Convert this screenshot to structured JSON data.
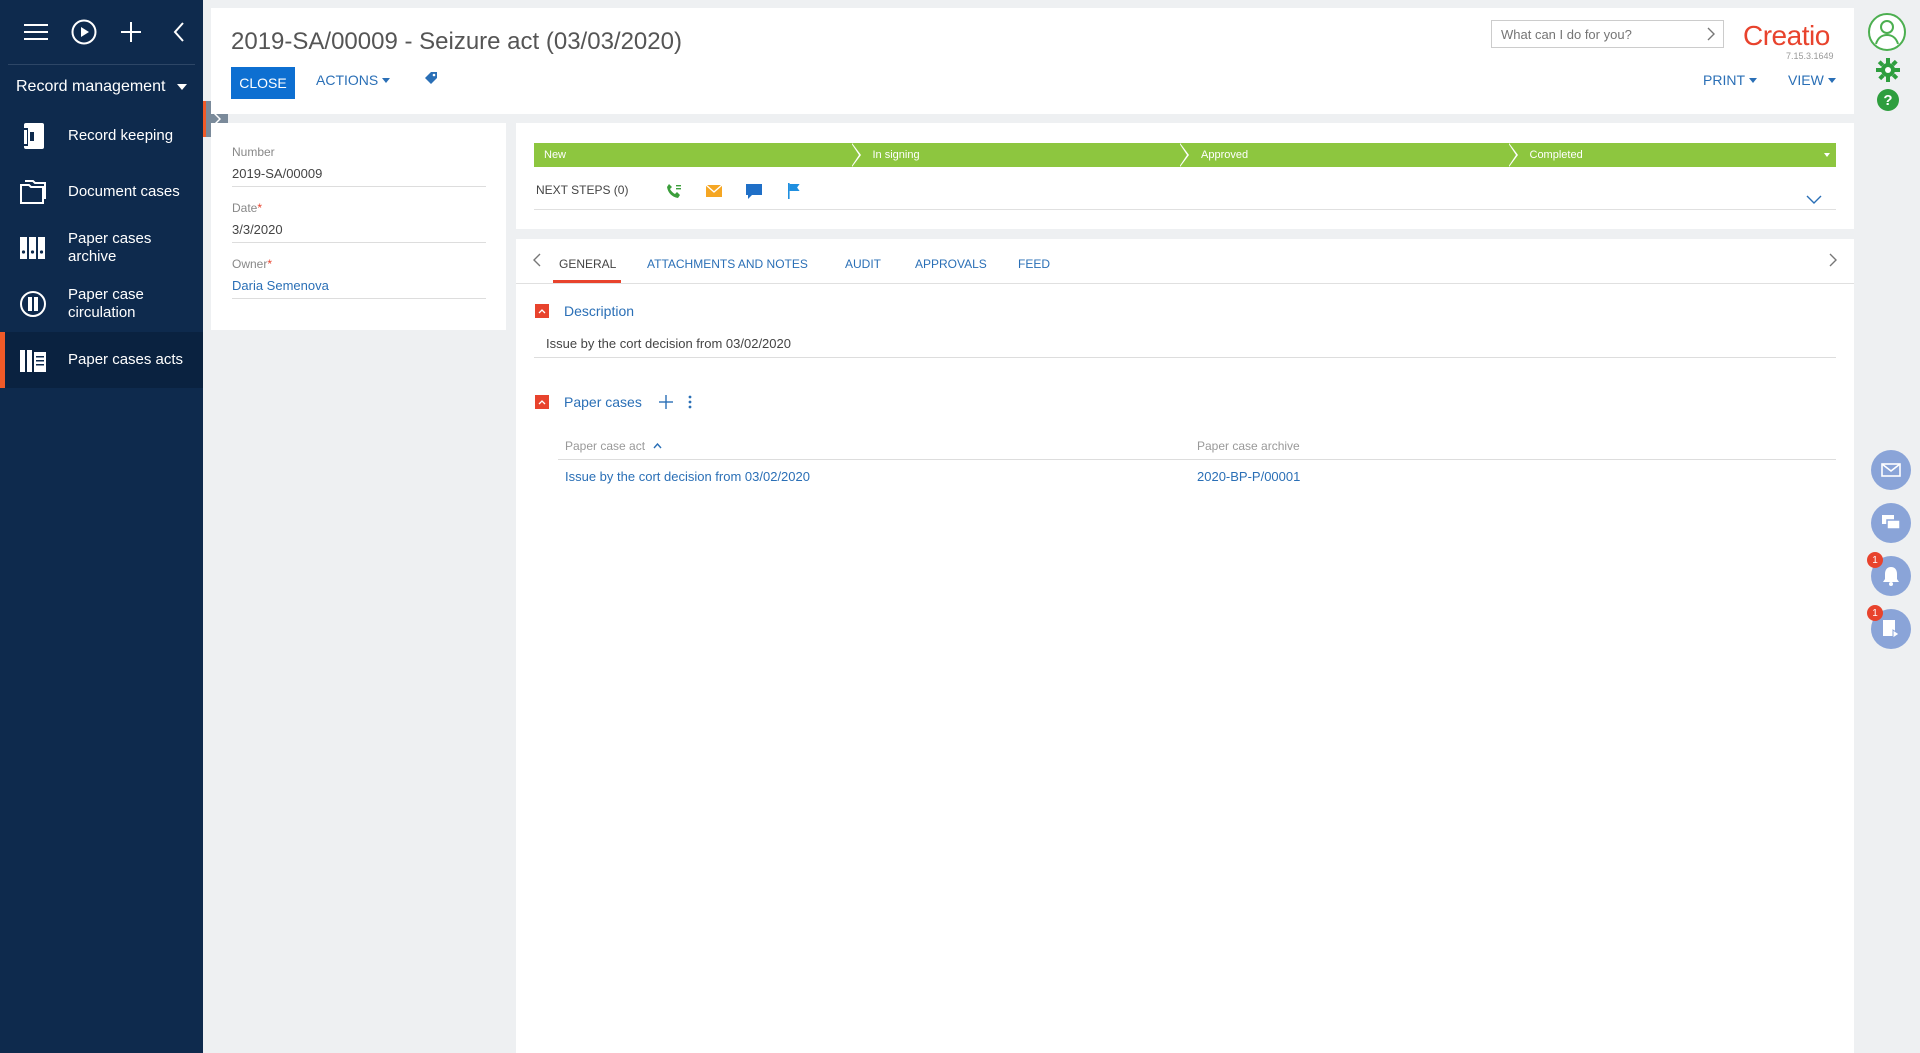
{
  "sidebar": {
    "workplace": "Record management",
    "items": [
      {
        "label": "Record keeping",
        "icon": "record-keeping-icon"
      },
      {
        "label": "Document cases",
        "icon": "folders-icon"
      },
      {
        "label": "Paper cases archive",
        "icon": "binders-icon"
      },
      {
        "label": "Paper case circulation",
        "icon": "circulation-icon"
      },
      {
        "label": "Paper cases acts",
        "icon": "acts-icon"
      }
    ]
  },
  "header": {
    "title": "2019-SA/00009 - Seizure act (03/03/2020)",
    "close_label": "CLOSE",
    "actions_label": "ACTIONS",
    "print_label": "PRINT",
    "view_label": "VIEW",
    "search_placeholder": "What can I do for you?",
    "logo": "Creatio",
    "version": "7.15.3.1649"
  },
  "fields": {
    "number_label": "Number",
    "number_value": "2019-SA/00009",
    "date_label": "Date",
    "date_value": "3/3/2020",
    "owner_label": "Owner",
    "owner_value": "Daria Semenova",
    "required_mark": "*"
  },
  "stages": [
    "New",
    "In signing",
    "Approved",
    "Completed"
  ],
  "next_steps_label": "NEXT STEPS (0)",
  "tabs": [
    "GENERAL",
    "ATTACHMENTS AND NOTES",
    "AUDIT",
    "APPROVALS",
    "FEED"
  ],
  "description": {
    "title": "Description",
    "text": "Issue by the cort decision from 03/02/2020"
  },
  "paper_cases": {
    "title": "Paper cases",
    "columns": [
      "Paper case act",
      "Paper case archive"
    ],
    "rows": [
      [
        "Issue by the cort decision from 03/02/2020",
        "2020-BP-P/00001"
      ]
    ]
  },
  "rail": {
    "notifications_count": "1",
    "tasks_count": "1"
  },
  "colors": {
    "sidebar": "#0e2a4d",
    "accent": "#e8432d",
    "primary": "#0d6fd1",
    "stage": "#8dc63f",
    "link": "#2a6fb6"
  }
}
